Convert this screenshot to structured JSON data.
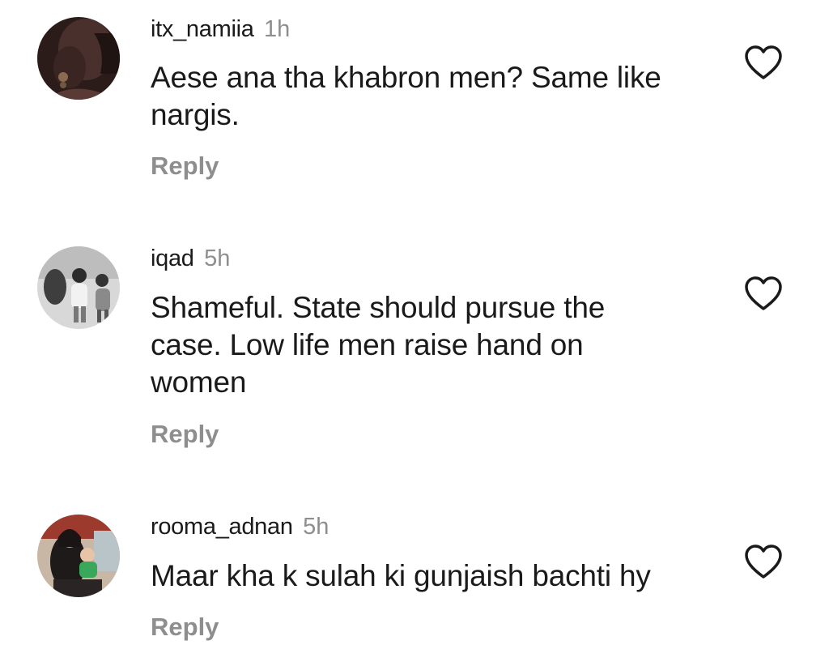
{
  "comments": [
    {
      "username": "itx_namiia",
      "time": "1h",
      "text": "Aese ana tha khabron men?  Same like nargis.",
      "reply_label": "Reply",
      "avatar_icon": "profile-photo",
      "like_icon": "heart-outline-icon"
    },
    {
      "username": "iqad",
      "time": "5h",
      "text": "Shameful. State should pursue the case. Low life men raise hand on women",
      "reply_label": "Reply",
      "avatar_icon": "profile-photo",
      "like_icon": "heart-outline-icon"
    },
    {
      "username": "rooma_adnan",
      "time": "5h",
      "text": "Maar kha k sulah ki gunjaish bachti hy",
      "reply_label": "Reply",
      "avatar_icon": "profile-photo",
      "like_icon": "heart-outline-icon"
    }
  ],
  "colors": {
    "text": "#1a1a1a",
    "muted": "#8e8e8e",
    "background": "#ffffff"
  }
}
